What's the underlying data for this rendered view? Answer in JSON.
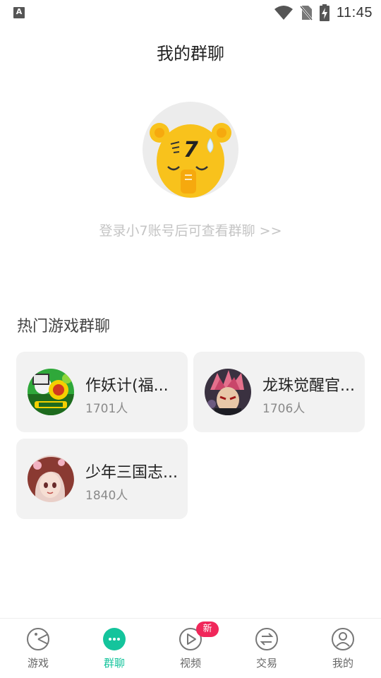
{
  "status_bar": {
    "time": "11:45",
    "left_icon_letter": "A",
    "icons": [
      "a-app-icon",
      "wifi-icon",
      "no-sim-icon",
      "battery-charging-icon"
    ]
  },
  "header": {
    "title": "我的群聊"
  },
  "login": {
    "prompt": "登录小7账号后可查看群聊 >>"
  },
  "hot_section": {
    "heading": "热门游戏群聊",
    "groups": [
      {
        "name": "作妖计(福...",
        "count": "1701人",
        "avatar": "game-avatar-zuoyaoji"
      },
      {
        "name": "龙珠觉醒官...",
        "count": "1706人",
        "avatar": "game-avatar-longzhu"
      },
      {
        "name": "少年三国志...",
        "count": "1840人",
        "avatar": "game-avatar-shaonian"
      }
    ]
  },
  "bottom_nav": {
    "items": [
      {
        "label": "游戏",
        "icon": "pacman-icon",
        "active": false
      },
      {
        "label": "群聊",
        "icon": "chat-dots-icon",
        "active": true
      },
      {
        "label": "视频",
        "icon": "play-icon",
        "active": false,
        "badge": "新"
      },
      {
        "label": "交易",
        "icon": "exchange-icon",
        "active": false
      },
      {
        "label": "我的",
        "icon": "user-icon",
        "active": false
      }
    ]
  },
  "colors": {
    "accent": "#14c49c",
    "badge": "#f0275a",
    "card_bg": "#f2f2f2",
    "mascot_yellow": "#f8c21c"
  }
}
